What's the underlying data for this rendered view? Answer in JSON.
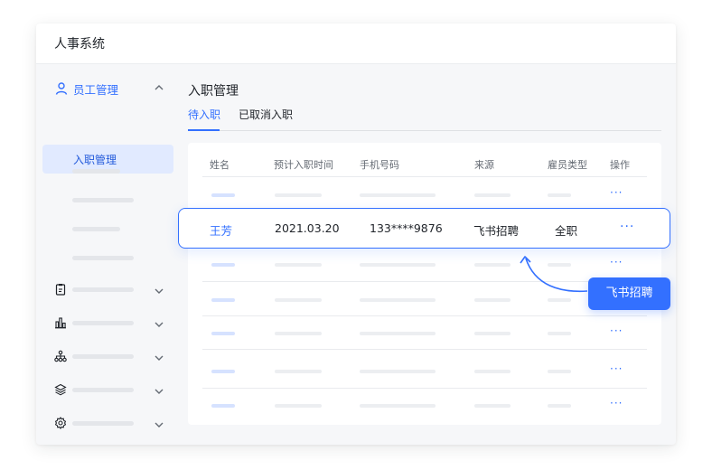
{
  "app": {
    "title": "人事系统"
  },
  "sidebar": {
    "section": {
      "label": "员工管理",
      "icon": "user-icon",
      "expanded": true
    },
    "active_item": {
      "label": "入职管理"
    },
    "groups": [
      {
        "icon": "clipboard-icon"
      },
      {
        "icon": "bar-chart-icon"
      },
      {
        "icon": "org-chart-icon"
      },
      {
        "icon": "layers-icon"
      },
      {
        "icon": "gear-icon"
      }
    ]
  },
  "main": {
    "title": "入职管理",
    "tabs": [
      {
        "label": "待入职",
        "active": true
      },
      {
        "label": "已取消入职",
        "active": false
      }
    ]
  },
  "table": {
    "columns": [
      "姓名",
      "预计入职时间",
      "手机号码",
      "来源",
      "雇员类型",
      "操作"
    ],
    "highlighted_row": {
      "name": "王芳",
      "date": "2021.03.20",
      "phone": "133****9876",
      "source": "飞书招聘",
      "type": "全职",
      "action": "···"
    },
    "row_action": "···"
  },
  "callout": {
    "label": "飞书招聘"
  },
  "colors": {
    "accent": "#3370ff",
    "active_bg": "#e1eaff",
    "page_bg": "#f6f7f9"
  }
}
